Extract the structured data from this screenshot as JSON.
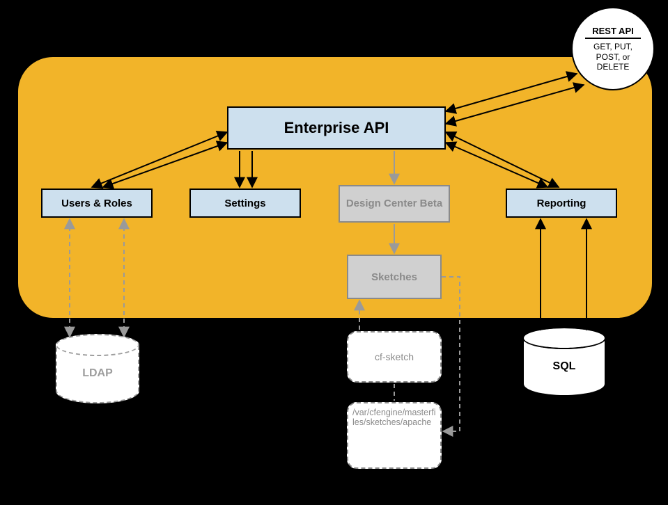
{
  "rest_circle": {
    "title": "REST API",
    "methods": "GET, PUT, POST, or DELETE"
  },
  "boxes": {
    "enterprise_api": "Enterprise API",
    "users_roles": "Users & Roles",
    "settings": "Settings",
    "design_center": "Design Center Beta",
    "reporting": "Reporting",
    "sketches": "Sketches",
    "cf_sketch": "cf-sketch",
    "masterfiles": "/var/cfengine/masterfiles/sketches/apache"
  },
  "cylinders": {
    "ldap": "LDAP",
    "sql": "SQL"
  }
}
